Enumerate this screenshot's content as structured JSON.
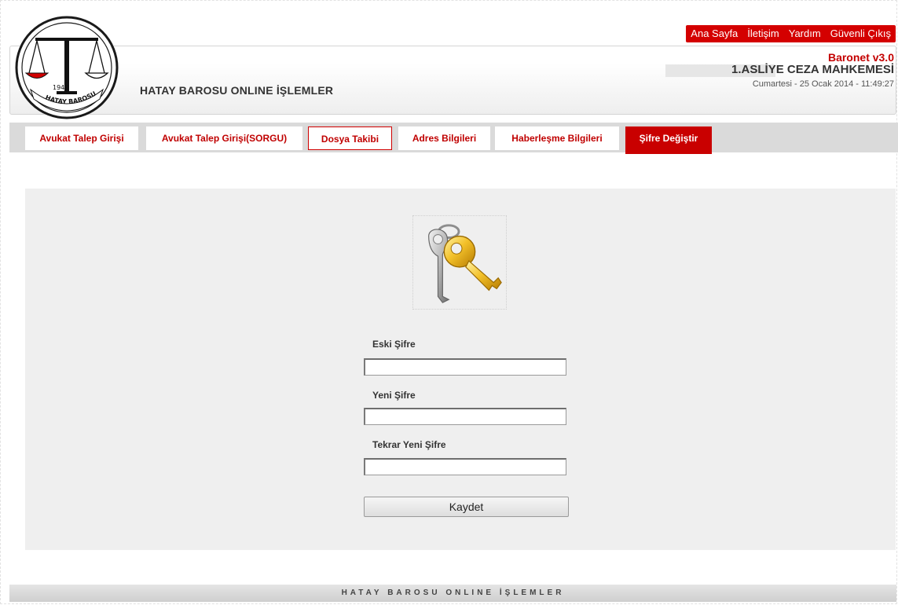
{
  "top_links": [
    "Ana Sayfa",
    "İletişim",
    "Yardım",
    "Güvenli Çıkış"
  ],
  "header": {
    "title": "HATAY BAROSU ONLINE İŞLEMLER",
    "version": "Baronet v3.0",
    "court": "1.ASLİYE CEZA MAHKEMESİ",
    "datetime": "Cumartesi - 25 Ocak 2014 - 11:49:27",
    "logo": {
      "year": "1943",
      "text": "HATAY BAROSU"
    }
  },
  "nav": {
    "tabs": [
      {
        "label": "Avukat Talep Girişi"
      },
      {
        "label": "Avukat Talep Girişi(SORGU)"
      },
      {
        "label": "Dosya Takibi"
      },
      {
        "label": "Adres Bilgileri"
      },
      {
        "label": "Haberleşme Bilgileri"
      },
      {
        "label": "Şifre Değiştir"
      }
    ],
    "active_tab": "Şifre Değiştir"
  },
  "form": {
    "icon": "keys-icon",
    "old_password_label": "Eski Şifre",
    "old_password_value": "",
    "new_password_label": "Yeni Şifre",
    "new_password_value": "",
    "repeat_password_label": "Tekrar Yeni Şifre",
    "repeat_password_value": "",
    "save_label": "Kaydet"
  },
  "footer": {
    "text": "HATAY BAROSU ONLINE İŞLEMLER"
  },
  "colors": {
    "accent": "#c90000",
    "panel": "#efefef",
    "nav": "#dadada"
  }
}
